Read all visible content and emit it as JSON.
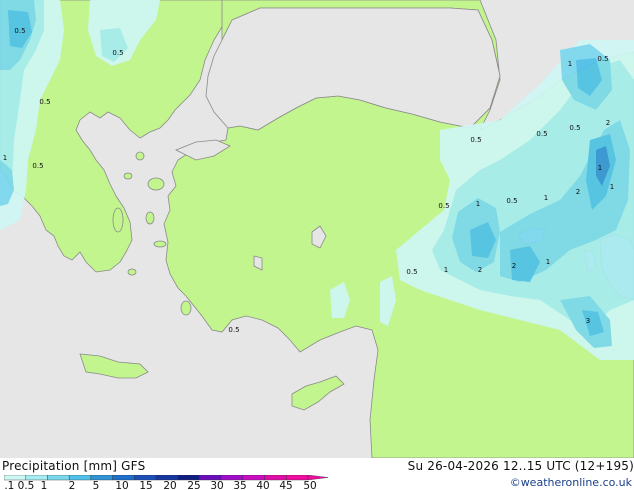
{
  "map": {
    "colors": {
      "sea": "#e6e6e6",
      "land": "#c2f58e",
      "coast": "#8a8a8a",
      "precip_01": "#cff7f5",
      "precip_05": "#a6ecf0",
      "precip_1": "#7ad8ee",
      "precip_2": "#4fc0ea",
      "precip_5": "#3193d6"
    },
    "contour_labels": [
      "0.5",
      "0.5",
      "0.5",
      "0.5",
      "0.5",
      "1",
      "0.5",
      "0.5",
      "1",
      "2",
      "1",
      "0.5",
      "0.5",
      "0.5",
      "1",
      "1",
      "2",
      "1",
      "0.5",
      "1",
      "2",
      "2",
      "1",
      "3",
      "0.5"
    ]
  },
  "footer": {
    "title": "Precipitation [mm] GFS",
    "datetime": "Su 26-04-2026 12..15 UTC (12+195)",
    "credit": "©weatheronline.co.uk",
    "legend": {
      "labels": [
        "0.1",
        "0.5",
        "1",
        "2",
        "5",
        "10",
        "15",
        "20",
        "25",
        "30",
        "35",
        "40",
        "45",
        "50"
      ],
      "colors": [
        "#cff7f5",
        "#a6ecf0",
        "#7ad8ee",
        "#4fc0ea",
        "#3193d6",
        "#1e6ecc",
        "#1a4fb8",
        "#1535a0",
        "#0f1e80",
        "#6a0cb8",
        "#a00cc8",
        "#c80cc0",
        "#e00ca8",
        "#f00ca0"
      ]
    }
  }
}
